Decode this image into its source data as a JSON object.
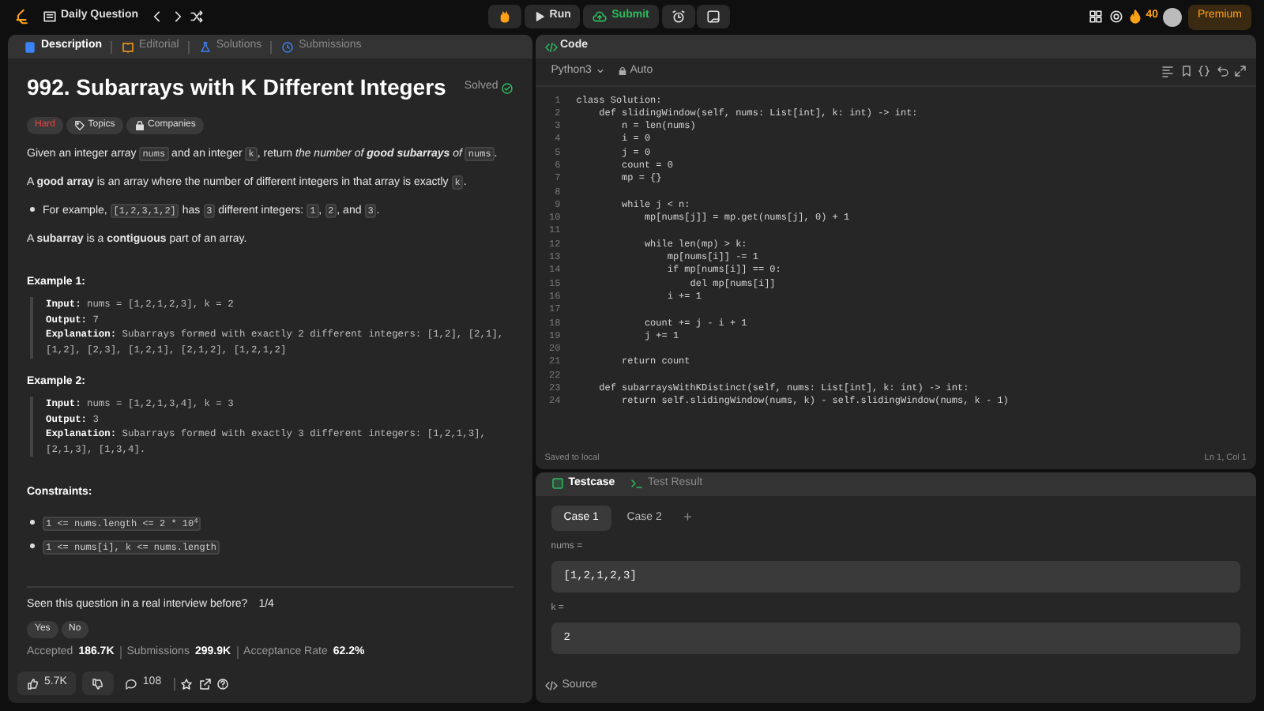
{
  "top_bar": {
    "title": "Daily Question",
    "run": "Run",
    "submit": "Submit",
    "streak": "40",
    "premium": "Premium"
  },
  "description_panel": {
    "tabs": [
      {
        "label": "Description",
        "selected": true
      },
      {
        "label": "Editorial",
        "selected": false
      },
      {
        "label": "Solutions",
        "selected": false
      },
      {
        "label": "Submissions",
        "selected": false
      }
    ],
    "title": "992. Subarrays with K Different Integers",
    "status": "Solved",
    "tags": [
      {
        "label": "Hard",
        "kind": "difficulty"
      },
      {
        "label": "Topics",
        "kind": "topics"
      },
      {
        "label": "Companies",
        "kind": "companies"
      }
    ],
    "paragraphs": [
      {
        "kind": "paragraph",
        "parts": [
          {
            "kind": "text",
            "text": "Given an integer array "
          },
          {
            "kind": "code",
            "text": "nums"
          },
          {
            "kind": "text",
            "text": " and an integer "
          },
          {
            "kind": "code",
            "text": "k"
          },
          {
            "kind": "text",
            "text": ", return "
          },
          {
            "kind": "emphasis",
            "text": "the number of **good subarrays** of "
          },
          {
            "kind": "code",
            "text": "nums"
          },
          {
            "kind": "text",
            "text": "."
          }
        ]
      },
      {
        "kind": "paragraph",
        "parts": [
          {
            "kind": "text",
            "text": "A **good array** is an array where the number of different integers in that array is exactly "
          },
          {
            "kind": "code",
            "text": "k"
          },
          {
            "kind": "text",
            "text": "."
          }
        ]
      },
      {
        "kind": "bullet",
        "parts": [
          {
            "kind": "text",
            "text": "For example, "
          },
          {
            "kind": "code",
            "text": "[1,2,3,1,2]"
          },
          {
            "kind": "text",
            "text": " has "
          },
          {
            "kind": "code",
            "text": "3"
          },
          {
            "kind": "text",
            "text": " different integers: "
          },
          {
            "kind": "code",
            "text": "1"
          },
          {
            "kind": "text",
            "text": ", "
          },
          {
            "kind": "code",
            "text": "2"
          },
          {
            "kind": "text",
            "text": ", and "
          },
          {
            "kind": "code",
            "text": "3"
          },
          {
            "kind": "text",
            "text": "."
          }
        ]
      },
      {
        "kind": "paragraph",
        "parts": [
          {
            "kind": "text",
            "text": "A **subarray** is a **contiguous** part of an array."
          }
        ]
      }
    ],
    "examples": [
      {
        "heading": "Example 1:",
        "lines": [
          "**Input:** nums = [1,2,1,2,3], k = 2",
          "**Output:** 7",
          "**Explanation:** Subarrays formed with exactly 2 different integers: [1,2], [2,1], [1,2], [2,3], [1,2,1], [2,1,2], [1,2,1,2]"
        ]
      },
      {
        "heading": "Example 2:",
        "lines": [
          "**Input:** nums = [1,2,1,3,4], k = 3",
          "**Output:** 3",
          "**Explanation:** Subarrays formed with exactly 3 different integers: [1,2,1,3], [2,1,3], [1,3,4]."
        ]
      }
    ],
    "constraints_heading": "Constraints:",
    "constraints": [
      "1 <= nums.length <= 2 * 10$^{4}$",
      "1 <= nums[i], k <= nums.length"
    ],
    "interview_question": "Seen this question in a real interview before?",
    "interview_page": "1/4",
    "answers": [
      "Yes",
      "No"
    ],
    "stats": [
      {
        "label": "Accepted",
        "value": "186.7K"
      },
      {
        "label": "Submissions",
        "value": "299.9K"
      },
      {
        "label": "Acceptance Rate",
        "value": "62.2%"
      }
    ],
    "likes": "5.7K",
    "comments": "108"
  },
  "code_panel": {
    "title": "Code",
    "language": "Python3",
    "mode": "Auto",
    "lines": [
      {
        "number": "1",
        "code": "class Solution:"
      },
      {
        "number": "2",
        "code": "    def slidingWindow(self, nums: List[int], k: int) -> int:"
      },
      {
        "number": "3",
        "code": "        n = len(nums)"
      },
      {
        "number": "4",
        "code": "        i = 0"
      },
      {
        "number": "5",
        "code": "        j = 0"
      },
      {
        "number": "6",
        "code": "        count = 0"
      },
      {
        "number": "7",
        "code": "        mp = {}"
      },
      {
        "number": "8"
      },
      {
        "number": "9",
        "code": "        while j < n:"
      },
      {
        "number": "10",
        "code": "            mp[nums[j]] = mp.get(nums[j], 0) + 1"
      },
      {
        "number": "11"
      },
      {
        "number": "12",
        "code": "            while len(mp) > k:"
      },
      {
        "number": "13",
        "code": "                mp[nums[i]] -= 1"
      },
      {
        "number": "14",
        "code": "                if mp[nums[i]] == 0:"
      },
      {
        "number": "15",
        "code": "                    del mp[nums[i]]"
      },
      {
        "number": "16",
        "code": "                i += 1"
      },
      {
        "number": "17"
      },
      {
        "number": "18",
        "code": "            count += j - i + 1"
      },
      {
        "number": "19",
        "code": "            j += 1"
      },
      {
        "number": "20"
      },
      {
        "number": "21",
        "code": "        return count"
      },
      {
        "number": "22"
      },
      {
        "number": "23",
        "code": "    def subarraysWithKDistinct(self, nums: List[int], k: int) -> int:"
      },
      {
        "number": "24",
        "code": "        return self.slidingWindow(nums, k) - self.slidingWindow(nums, k - 1)"
      }
    ],
    "saved": "Saved to local",
    "cursor": "Ln 1, Col 1"
  },
  "test_panel": {
    "tabs": [
      {
        "label": "Testcase",
        "selected": true
      },
      {
        "label": "Test Result",
        "selected": false
      }
    ],
    "cases": [
      {
        "label": "Case 1",
        "selected": true
      },
      {
        "label": "Case 2",
        "selected": false
      }
    ],
    "add": "+",
    "inputs": [
      {
        "label": "nums =",
        "value": "[1,2,1,2,3]"
      },
      {
        "label": "k =",
        "value": "2"
      }
    ],
    "source": "Source"
  }
}
